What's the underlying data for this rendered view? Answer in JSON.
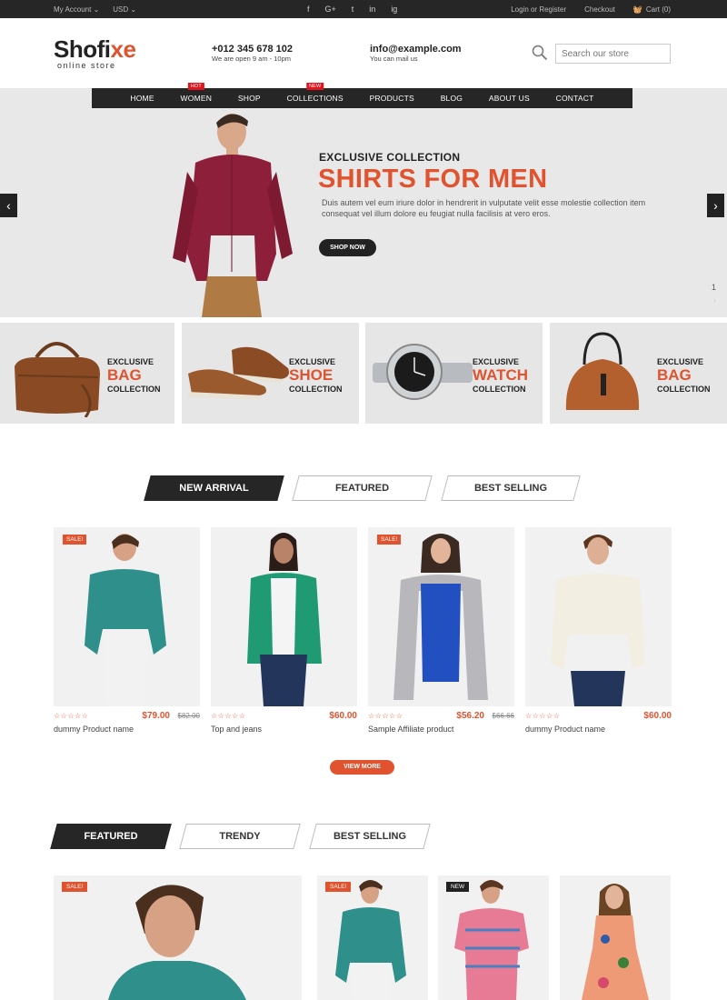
{
  "topbar": {
    "my_account": "My Account ⌄",
    "currency": "USD ⌄",
    "social": [
      "f",
      "G+",
      "t",
      "in",
      "ig"
    ],
    "login": "Login or Register",
    "checkout": "Checkout",
    "cart": "Cart (0)"
  },
  "header": {
    "logo_main_a": "Shofi",
    "logo_main_b": "xe",
    "logo_sub": "online store",
    "phone": "+012 345 678 102",
    "phone_sub": "We are open 9 am - 10pm",
    "email": "info@example.com",
    "email_sub": "You can mail us",
    "search_placeholder": "Search our store"
  },
  "nav": {
    "items": [
      "HOME",
      "WOMEN",
      "SHOP",
      "COLLECTIONS",
      "PRODUCTS",
      "BLOG",
      "ABOUT US",
      "CONTACT"
    ],
    "badge_hot": "HOT",
    "badge_new": "NEW"
  },
  "hero": {
    "eyebrow": "EXCLUSIVE COLLECTION",
    "headline": "SHIRTS FOR MEN",
    "desc_1": "Duis autem vel eum iriure dolor in hendrerit in vulputate velit esse molestie collection item",
    "desc_2": "consequat vel illum dolore eu feugiat nulla facilisis at vero eros.",
    "button": "SHOP NOW",
    "slide_current": "1"
  },
  "categories": [
    {
      "pre": "EXCLUSIVE",
      "name": "BAG",
      "post": "COLLECTION"
    },
    {
      "pre": "EXCLUSIVE",
      "name": "SHOE",
      "post": "COLLECTION"
    },
    {
      "pre": "EXCLUSIVE",
      "name": "WATCH",
      "post": "COLLECTION"
    },
    {
      "pre": "EXCLUSIVE",
      "name": "BAG",
      "post": "COLLECTION"
    }
  ],
  "tabs_1": [
    "NEW ARRIVAL",
    "FEATURED",
    "BEST SELLING"
  ],
  "products": [
    {
      "name": "dummy Product name",
      "price": "$79.00",
      "old": "$82.00",
      "sale": "SALE!",
      "stars": "☆☆☆☆☆"
    },
    {
      "name": "Top and jeans",
      "price": "$60.00",
      "stars": "☆☆☆☆☆"
    },
    {
      "name": "Sample Affiliate product",
      "price": "$56.20",
      "old": "$66.66",
      "sale": "SALE!",
      "stars": "☆☆☆☆☆"
    },
    {
      "name": "dummy Product name",
      "price": "$60.00",
      "stars": "☆☆☆☆☆"
    }
  ],
  "view_more": "VIEW MORE",
  "tabs_2": [
    "FEATURED",
    "TRENDY",
    "BEST SELLING"
  ],
  "featured_tags": [
    "SALE!",
    "SALE!",
    "NEW"
  ],
  "colors": {
    "accent": "#e0532e",
    "dark": "#262626"
  }
}
